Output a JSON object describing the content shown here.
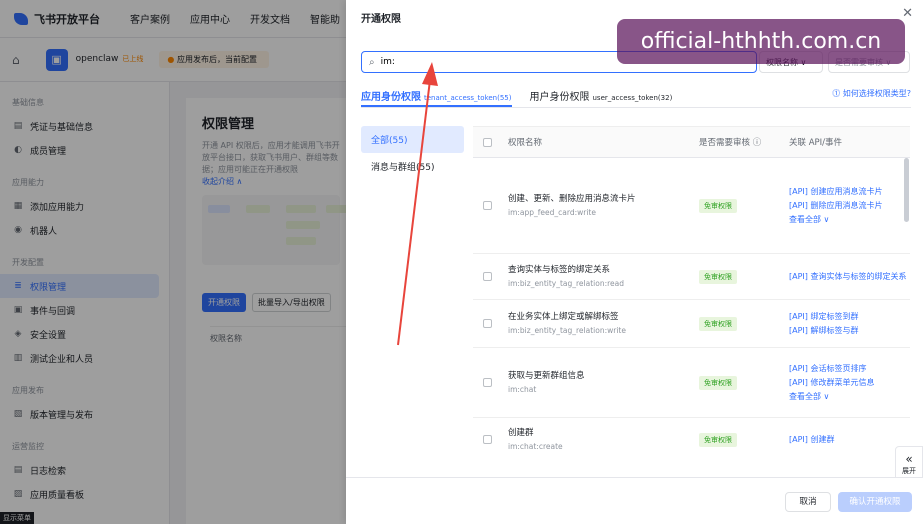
{
  "topnav": {
    "logo": "飞书开放平台",
    "links": [
      "客户案例",
      "应用中心",
      "开发文档",
      "智能助"
    ]
  },
  "app": {
    "icon_glyph": "▣",
    "name": "openclaw",
    "tag": "已上线",
    "notice": "应用发布后，当前配置"
  },
  "sidebar": {
    "groups": [
      {
        "title": "基础信息",
        "items": [
          {
            "label": "凭证与基础信息",
            "icon": "key-icon"
          },
          {
            "label": "成员管理",
            "icon": "user-icon"
          }
        ]
      },
      {
        "title": "应用能力",
        "items": [
          {
            "label": "添加应用能力",
            "icon": "grid-icon"
          },
          {
            "label": "机器人",
            "icon": "bot-icon"
          }
        ]
      },
      {
        "title": "开发配置",
        "items": [
          {
            "label": "权限管理",
            "icon": "list-icon",
            "active": true
          },
          {
            "label": "事件与回调",
            "icon": "event-icon"
          },
          {
            "label": "安全设置",
            "icon": "shield-icon"
          },
          {
            "label": "测试企业和人员",
            "icon": "test-icon"
          }
        ]
      },
      {
        "title": "应用发布",
        "items": [
          {
            "label": "版本管理与发布",
            "icon": "version-icon"
          }
        ]
      },
      {
        "title": "运营监控",
        "items": [
          {
            "label": "日志检索",
            "icon": "log-icon"
          },
          {
            "label": "应用质量看板",
            "icon": "chart-icon"
          }
        ]
      }
    ],
    "show_menu": "显示菜单"
  },
  "main": {
    "title": "权限管理",
    "desc": "开通 API 权限后，应用才能调用飞书开放平台接口，获取飞书用户、群组等数据；应用可能正在开通权限",
    "collapse": "收起介绍 ∧",
    "btn_open": "开通权限",
    "btn_import": "批量导入/导出权限",
    "col_name": "权限名称"
  },
  "drawer": {
    "title": "开通权限",
    "close": "✕",
    "search_value": "im:",
    "search_icon": "search-icon",
    "select_name": "权限名称 ∨",
    "select_audit": "是否需要审核 ∨",
    "tabs": [
      {
        "label": "应用身份权限",
        "token": "tenant_access_token(55)",
        "active": true
      },
      {
        "label": "用户身份权限",
        "token": "user_access_token(32)"
      }
    ],
    "help": "⓵ 如何选择权限类型?",
    "categories": [
      {
        "label": "全部(55)",
        "active": true
      },
      {
        "label": "消息与群组(55)"
      }
    ],
    "columns": {
      "name": "权限名称",
      "audit": "是否需要审核 ⓘ",
      "api": "关联 API/事件"
    },
    "rows": [
      {
        "name": "创建、更新、删除应用消息流卡片",
        "code": "im:app_feed_card:write",
        "audit": "免审权限",
        "apis": [
          "[API] 创建应用消息流卡片",
          "[API] 删除应用消息流卡片"
        ],
        "more": "查看全部 ∨"
      },
      {
        "name": "查询实体与标签的绑定关系",
        "code": "im:biz_entity_tag_relation:read",
        "audit": "免审权限",
        "apis": [
          "[API] 查询实体与标签的绑定关系"
        ]
      },
      {
        "name": "在业务实体上绑定或解绑标签",
        "code": "im:biz_entity_tag_relation:write",
        "audit": "免审权限",
        "apis": [
          "[API] 绑定标签到群",
          "[API] 解绑标签与群"
        ]
      },
      {
        "name": "获取与更新群组信息",
        "code": "im:chat",
        "audit": "免审权限",
        "apis": [
          "[API] 会话标签页排序",
          "[API] 修改群菜单元信息"
        ],
        "more": "查看全部 ∨"
      },
      {
        "name": "创建群",
        "code": "im:chat:create",
        "audit": "免审权限",
        "apis": [
          "[API] 创建群"
        ]
      }
    ],
    "expand": "展开",
    "cancel": "取消",
    "confirm": "确认开通权限"
  },
  "watermark": "official-hthhth.com.cn",
  "colors": {
    "accent": "#3370ff",
    "badge_green": "#2ea121",
    "arrow_red": "#e8453c"
  }
}
